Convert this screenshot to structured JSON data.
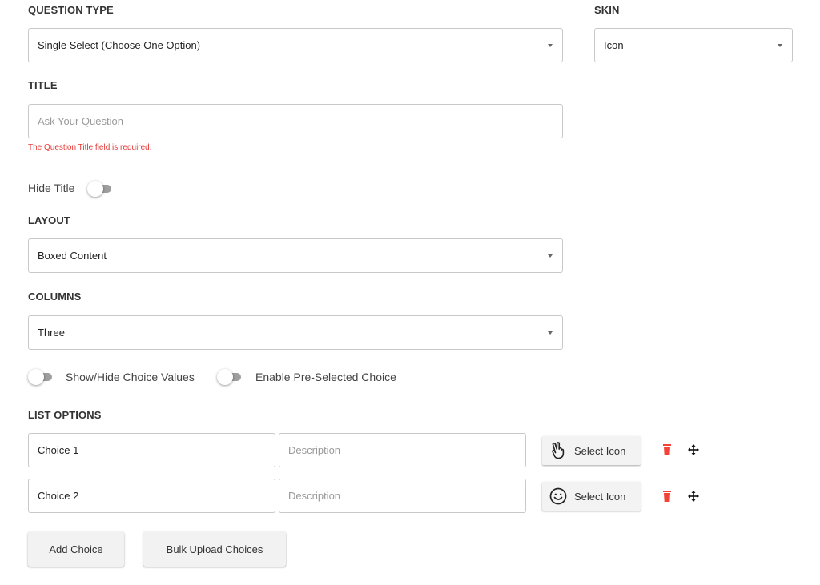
{
  "question_type": {
    "label": "QUESTION TYPE",
    "value": "Single Select (Choose One Option)"
  },
  "skin": {
    "label": "SKIN",
    "value": "Icon"
  },
  "title": {
    "label": "TITLE",
    "placeholder": "Ask Your Question",
    "error": "The Question Title field is required."
  },
  "hide_title": {
    "label": "Hide Title",
    "on": false
  },
  "layout": {
    "label": "LAYOUT",
    "value": "Boxed Content"
  },
  "columns": {
    "label": "COLUMNS",
    "value": "Three"
  },
  "toggles": {
    "show_hide_values": "Show/Hide Choice Values",
    "enable_preselected": "Enable Pre-Selected Choice"
  },
  "list_options": {
    "label": "LIST OPTIONS",
    "choices": [
      {
        "value": "Choice 1",
        "description_placeholder": "Description",
        "icon": "hand-peace-icon",
        "select_icon_label": "Select Icon"
      },
      {
        "value": "Choice 2",
        "description_placeholder": "Description",
        "icon": "smiley-icon",
        "select_icon_label": "Select Icon"
      }
    ]
  },
  "buttons": {
    "add_choice": "Add Choice",
    "bulk_upload": "Bulk Upload Choices"
  },
  "colors": {
    "error": "#e53935",
    "delete": "#f44336"
  }
}
